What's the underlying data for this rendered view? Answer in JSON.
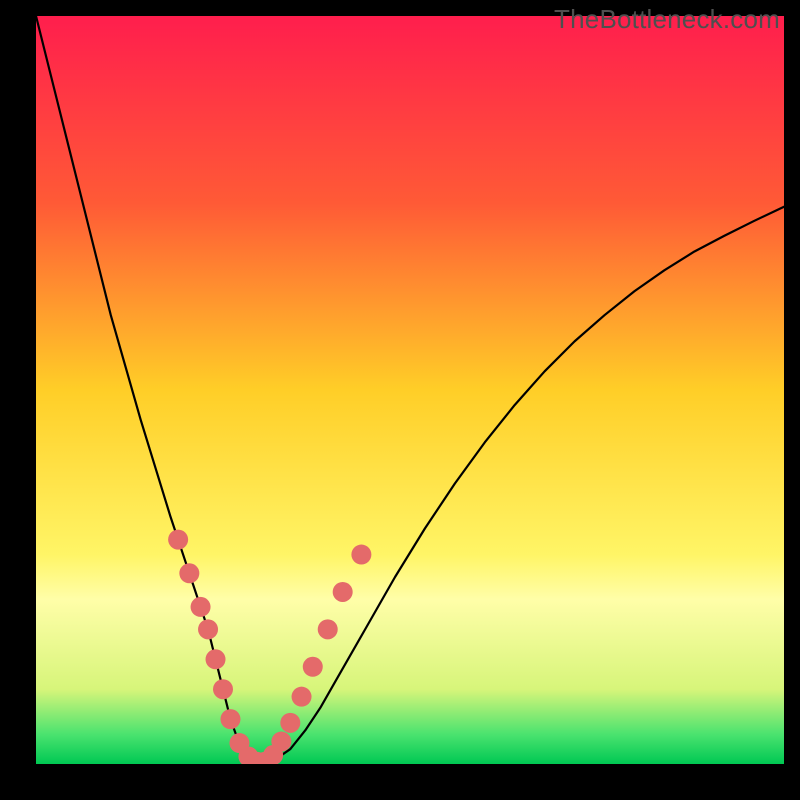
{
  "watermark": "TheBottleneck.com",
  "chart_data": {
    "type": "line",
    "title": "",
    "xlabel": "",
    "ylabel": "",
    "xlim": [
      0,
      100
    ],
    "ylim": [
      0,
      100
    ],
    "background_gradient": {
      "stops": [
        {
          "y": 0,
          "color": "#ff1e4d"
        },
        {
          "y": 25,
          "color": "#ff5a36"
        },
        {
          "y": 50,
          "color": "#ffce27"
        },
        {
          "y": 72,
          "color": "#fff566"
        },
        {
          "y": 78,
          "color": "#fffea8"
        },
        {
          "y": 90,
          "color": "#d7f57a"
        },
        {
          "y": 96,
          "color": "#4be36f"
        },
        {
          "y": 100,
          "color": "#00c853"
        }
      ]
    },
    "series": [
      {
        "name": "bottleneck-curve",
        "stroke": "#000000",
        "stroke_width": 2.2,
        "x": [
          0,
          2,
          4,
          6,
          8,
          10,
          12,
          14,
          16,
          18,
          20,
          21,
          22,
          23,
          24,
          25,
          26,
          27,
          28,
          29,
          30,
          32,
          34,
          36,
          38,
          40,
          44,
          48,
          52,
          56,
          60,
          64,
          68,
          72,
          76,
          80,
          84,
          88,
          92,
          96,
          100
        ],
        "values": [
          100,
          92,
          84,
          76,
          68,
          60,
          53,
          46,
          39.5,
          33,
          27,
          24,
          21,
          18,
          14,
          10,
          6,
          3.2,
          1.4,
          0.4,
          0,
          0.6,
          2,
          4.5,
          7.5,
          11,
          18,
          25,
          31.5,
          37.5,
          43,
          48,
          52.5,
          56.5,
          60,
          63.2,
          66,
          68.5,
          70.6,
          72.6,
          74.5
        ]
      }
    ],
    "markers": {
      "name": "highlight-points",
      "fill": "#e46a6a",
      "radius": 10,
      "points": [
        {
          "x": 19,
          "y": 30
        },
        {
          "x": 20.5,
          "y": 25.5
        },
        {
          "x": 22,
          "y": 21
        },
        {
          "x": 23,
          "y": 18
        },
        {
          "x": 24,
          "y": 14
        },
        {
          "x": 25,
          "y": 10
        },
        {
          "x": 26,
          "y": 6
        },
        {
          "x": 27.2,
          "y": 2.8
        },
        {
          "x": 28.4,
          "y": 1.0
        },
        {
          "x": 29.5,
          "y": 0.3
        },
        {
          "x": 30.6,
          "y": 0.3
        },
        {
          "x": 31.7,
          "y": 1.2
        },
        {
          "x": 32.8,
          "y": 3.0
        },
        {
          "x": 34,
          "y": 5.5
        },
        {
          "x": 35.5,
          "y": 9
        },
        {
          "x": 37,
          "y": 13
        },
        {
          "x": 39,
          "y": 18
        },
        {
          "x": 41,
          "y": 23
        },
        {
          "x": 43.5,
          "y": 28
        }
      ]
    }
  }
}
